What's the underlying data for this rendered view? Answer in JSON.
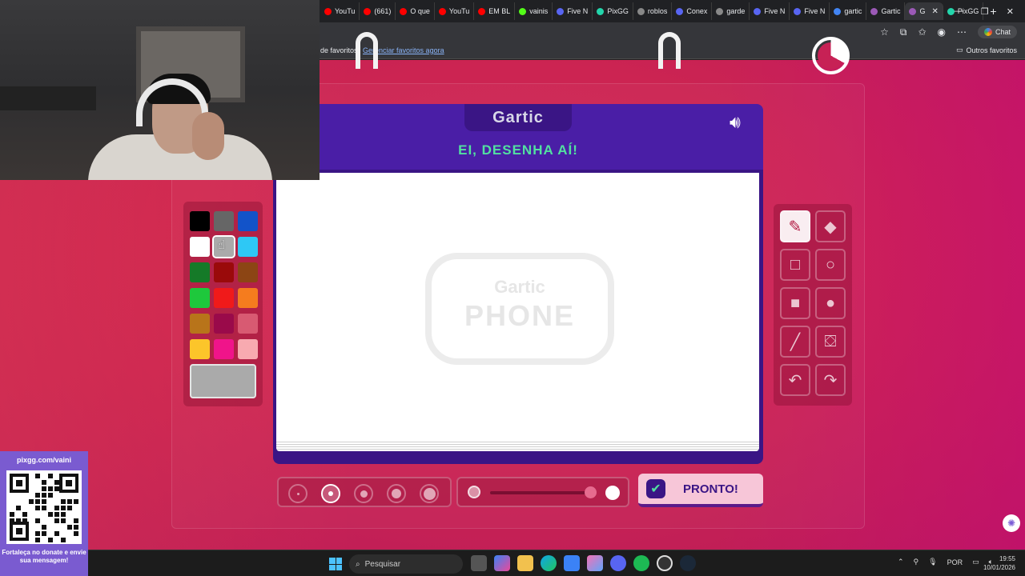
{
  "browser": {
    "tabs": [
      {
        "label": "YouTu",
        "color": "#ff0000"
      },
      {
        "label": "(661)",
        "color": "#ff0000"
      },
      {
        "label": "O que",
        "color": "#ff0000"
      },
      {
        "label": "YouTu",
        "color": "#ff0000"
      },
      {
        "label": "EM BL",
        "color": "#ff0000"
      },
      {
        "label": "vainis",
        "color": "#53fc18"
      },
      {
        "label": "Five N",
        "color": "#5865f2"
      },
      {
        "label": "PixGG",
        "color": "#23d5ab"
      },
      {
        "label": "roblos",
        "color": "#888888"
      },
      {
        "label": "Conex",
        "color": "#5865f2"
      },
      {
        "label": "garde",
        "color": "#888888"
      },
      {
        "label": "Five N",
        "color": "#5865f2"
      },
      {
        "label": "Five N",
        "color": "#5865f2"
      },
      {
        "label": "gartic",
        "color": "#4285f4"
      },
      {
        "label": "Gartic",
        "color": "#9b59b6"
      },
      {
        "label": "G",
        "color": "#9b59b6",
        "active": true
      },
      {
        "label": "PixGG",
        "color": "#23d5ab"
      }
    ],
    "new_tab": "+",
    "chat_label": "Chat",
    "bookmarks_text": "de favoritos.",
    "manage_bookmarks_link": "Gerenciar favoritos agora",
    "other_bookmarks": "Outros favoritos"
  },
  "game": {
    "logo": "Gartic",
    "title": "EI, DESENHA AÍ!",
    "watermark_line1": "Gartic",
    "watermark_line2": "PHONE",
    "palette": [
      "#000000",
      "#666666",
      "#1253c9",
      "#ffffff",
      "#aaaaaa",
      "#2ec8f5",
      "#157a28",
      "#9a0a0a",
      "#8c4514",
      "#1ec83c",
      "#f01a1a",
      "#f57c1e",
      "#b8741a",
      "#9a0a4a",
      "#d85a72",
      "#fcc52a",
      "#f0148a",
      "#f8aab0"
    ],
    "selected_color": "#aaaaaa",
    "tools": [
      "pencil-icon",
      "eraser-icon",
      "rectangle-outline-icon",
      "circle-outline-icon",
      "rectangle-fill-icon",
      "circle-fill-icon",
      "line-icon",
      "bucket-icon",
      "undo-icon",
      "redo-icon"
    ],
    "active_tool": "pencil-icon",
    "brush_sizes_count": 5,
    "selected_brush_size_index": 1,
    "done_button": "PRONTO!"
  },
  "overlay": {
    "qr_url": "pixgg.com/vaini",
    "qr_message": "Fortaleça no donate e envie sua mensagem!"
  },
  "taskbar": {
    "search_placeholder": "Pesquisar",
    "language": "POR",
    "time": "19:55",
    "date": "10/01/2026"
  }
}
